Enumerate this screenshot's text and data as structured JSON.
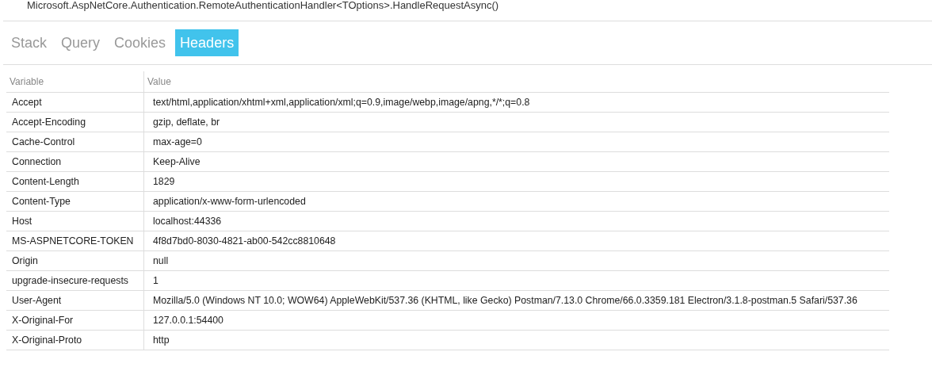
{
  "method_line": "Microsoft.AspNetCore.Authentication.RemoteAuthenticationHandler<TOptions>.HandleRequestAsync()",
  "tabs": [
    {
      "label": "Stack",
      "selected": false
    },
    {
      "label": "Query",
      "selected": false
    },
    {
      "label": "Cookies",
      "selected": false
    },
    {
      "label": "Headers",
      "selected": true
    }
  ],
  "table": {
    "columns": [
      "Variable",
      "Value"
    ],
    "rows": [
      [
        "Accept",
        "text/html,application/xhtml+xml,application/xml;q=0.9,image/webp,image/apng,*/*;q=0.8"
      ],
      [
        "Accept-Encoding",
        "gzip, deflate, br"
      ],
      [
        "Cache-Control",
        "max-age=0"
      ],
      [
        "Connection",
        "Keep-Alive"
      ],
      [
        "Content-Length",
        "1829"
      ],
      [
        "Content-Type",
        "application/x-www-form-urlencoded"
      ],
      [
        "Host",
        "localhost:44336"
      ],
      [
        "MS-ASPNETCORE-TOKEN",
        "4f8d7bd0-8030-4821-ab00-542cc8810648"
      ],
      [
        "Origin",
        "null"
      ],
      [
        "upgrade-insecure-requests",
        "1"
      ],
      [
        "User-Agent",
        "Mozilla/5.0 (Windows NT 10.0; WOW64) AppleWebKit/537.36 (KHTML, like Gecko) Postman/7.13.0 Chrome/66.0.3359.181 Electron/3.1.8-postman.5 Safari/537.36"
      ],
      [
        "X-Original-For",
        "127.0.0.1:54400"
      ],
      [
        "X-Original-Proto",
        "http"
      ]
    ]
  }
}
